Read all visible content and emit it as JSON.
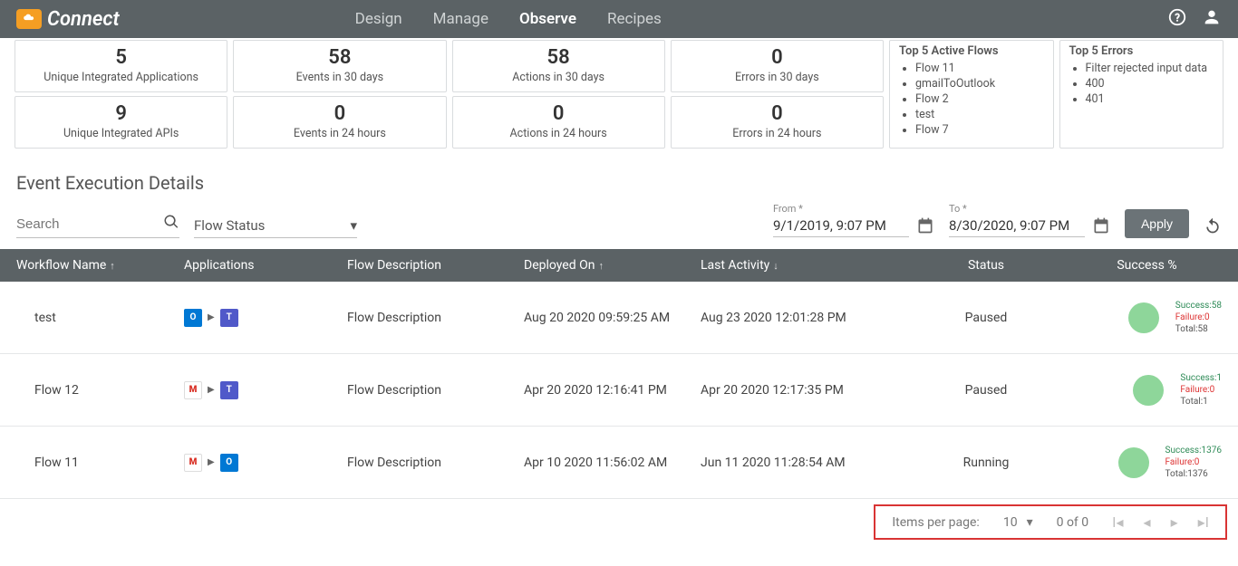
{
  "logo_text": "Connect",
  "nav": {
    "design": "Design",
    "manage": "Manage",
    "observe": "Observe",
    "recipes": "Recipes"
  },
  "stats30": {
    "apps": {
      "num": "5",
      "lbl": "Unique Integrated Applications"
    },
    "events": {
      "num": "58",
      "lbl": "Events in 30 days"
    },
    "actions": {
      "num": "58",
      "lbl": "Actions in 30 days"
    },
    "errors": {
      "num": "0",
      "lbl": "Errors in 30 days"
    }
  },
  "stats24": {
    "apis": {
      "num": "9",
      "lbl": "Unique Integrated APIs"
    },
    "events": {
      "num": "0",
      "lbl": "Events in 24 hours"
    },
    "actions": {
      "num": "0",
      "lbl": "Actions in 24 hours"
    },
    "errors": {
      "num": "0",
      "lbl": "Errors in 24 hours"
    }
  },
  "top5flows": {
    "title": "Top 5 Active Flows",
    "items": [
      "Flow 11",
      "gmailToOutlook",
      "Flow 2",
      "test",
      "Flow 7"
    ]
  },
  "top5errors": {
    "title": "Top 5 Errors",
    "items": [
      "Filter rejected input data",
      "400",
      "401"
    ]
  },
  "section_title": "Event Execution Details",
  "search_placeholder": "Search",
  "flow_status_label": "Flow Status",
  "from": {
    "label": "From *",
    "value": "9/1/2019, 9:07 PM"
  },
  "to": {
    "label": "To *",
    "value": "8/30/2020, 9:07 PM"
  },
  "apply_label": "Apply",
  "cols": {
    "name": "Workflow Name",
    "apps": "Applications",
    "desc": "Flow Description",
    "dep": "Deployed On",
    "act": "Last Activity",
    "status": "Status",
    "succ": "Success %"
  },
  "rows": [
    {
      "name": "test",
      "apps": [
        {
          "name": "outlook-icon",
          "bg": "#0078d4",
          "txt": "O"
        },
        {
          "name": "teams-icon",
          "bg": "#5059c9",
          "txt": "T"
        }
      ],
      "desc": "Flow Description",
      "dep": "Aug 20 2020 09:59:25 AM",
      "act": "Aug 23 2020 12:01:28 PM",
      "status": "Paused",
      "success": "Success:58",
      "failure": "Failure:0",
      "total": "Total:58"
    },
    {
      "name": "Flow 12",
      "apps": [
        {
          "name": "gmail-icon",
          "bg": "#ffffff",
          "txt": "M",
          "style": "gmail"
        },
        {
          "name": "teams-icon",
          "bg": "#5059c9",
          "txt": "T"
        }
      ],
      "desc": "Flow Description",
      "dep": "Apr 20 2020 12:16:41 PM",
      "act": "Apr 20 2020 12:17:35 PM",
      "status": "Paused",
      "success": "Success:1",
      "failure": "Failure:0",
      "total": "Total:1"
    },
    {
      "name": "Flow 11",
      "apps": [
        {
          "name": "gmail-icon",
          "bg": "#ffffff",
          "txt": "M",
          "style": "gmail"
        },
        {
          "name": "outlook-icon",
          "bg": "#0078d4",
          "txt": "O"
        }
      ],
      "desc": "Flow Description",
      "dep": "Apr 10 2020 11:56:02 AM",
      "act": "Jun 11 2020 11:28:54 AM",
      "status": "Running",
      "success": "Success:1376",
      "failure": "Failure:0",
      "total": "Total:1376"
    }
  ],
  "pager": {
    "ipp_label": "Items per page:",
    "ipp_value": "10",
    "range": "0 of 0"
  }
}
